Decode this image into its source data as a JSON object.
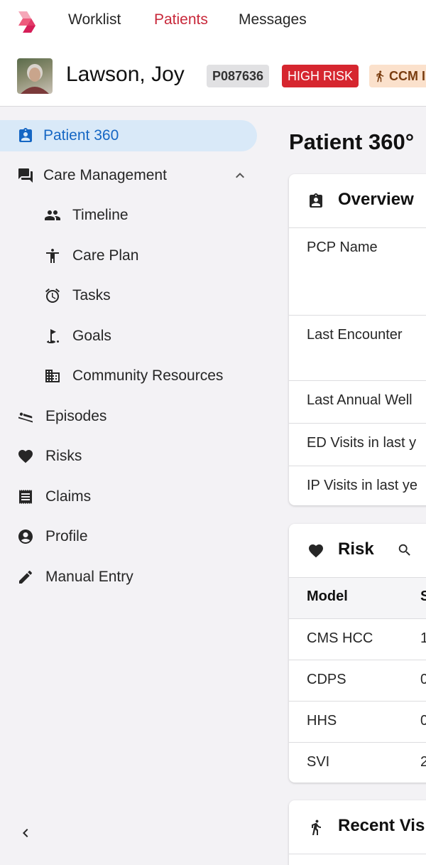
{
  "nav": {
    "items": [
      {
        "label": "Worklist",
        "active": false
      },
      {
        "label": "Patients",
        "active": true
      },
      {
        "label": "Messages",
        "active": false
      }
    ]
  },
  "patient": {
    "name": "Lawson, Joy",
    "id": "P087636",
    "risk_badge": "HIGH RISK",
    "program_badge": "CCM I"
  },
  "sidebar": {
    "items": [
      {
        "label": "Patient 360",
        "icon": "contact-card-icon",
        "active": true
      },
      {
        "label": "Care Management",
        "icon": "forum-icon",
        "expanded": true
      },
      {
        "label": "Timeline",
        "icon": "people-icon"
      },
      {
        "label": "Care Plan",
        "icon": "accessibility-icon"
      },
      {
        "label": "Tasks",
        "icon": "alarm-icon"
      },
      {
        "label": "Goals",
        "icon": "golf-flag-icon"
      },
      {
        "label": "Community Resources",
        "icon": "building-icon"
      },
      {
        "label": "Episodes",
        "icon": "bed-icon"
      },
      {
        "label": "Risks",
        "icon": "heart-icon"
      },
      {
        "label": "Claims",
        "icon": "receipt-icon"
      },
      {
        "label": "Profile",
        "icon": "account-circle-icon"
      },
      {
        "label": "Manual Entry",
        "icon": "pencil-icon"
      }
    ]
  },
  "main": {
    "title": "Patient 360°",
    "overview": {
      "title": "Overview",
      "rows": [
        "PCP Name",
        "Last Encounter",
        "Last Annual Well",
        "ED Visits in last y",
        "IP Visits in last ye"
      ]
    },
    "risk": {
      "title": "Risk",
      "columns": [
        "Model",
        "S"
      ],
      "rows": [
        {
          "model": "CMS HCC",
          "score": "1"
        },
        {
          "model": "CDPS",
          "score": "0"
        },
        {
          "model": "HHS",
          "score": "0"
        },
        {
          "model": "SVI",
          "score": "2"
        }
      ]
    },
    "recent_visits": {
      "title": "Recent Vis"
    }
  },
  "colors": {
    "brand_red": "#c8283a",
    "active_blue": "#1667c4",
    "active_bg": "#d9e9f8",
    "high_risk": "#d6262f",
    "ccm_bg": "#fbe1cc"
  }
}
